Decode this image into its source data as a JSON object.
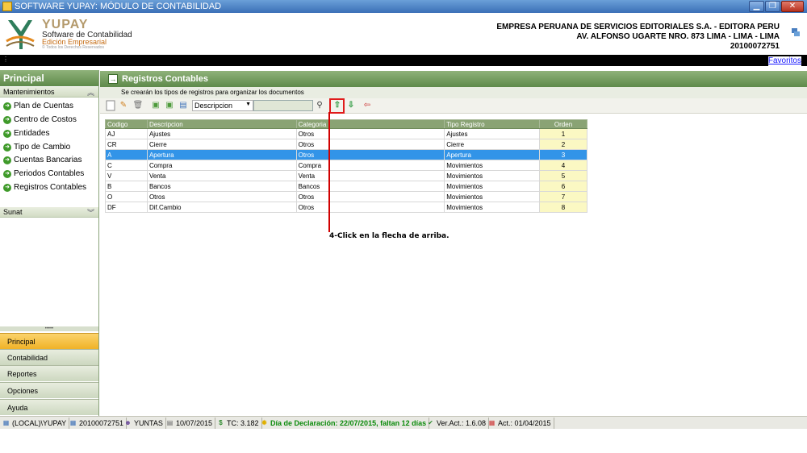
{
  "window": {
    "title": "SOFTWARE YUPAY: MÓDULO DE CONTABILIDAD",
    "minimize": "▁",
    "restore": "❐",
    "close": "✕"
  },
  "header": {
    "brand": "YUPAY",
    "tagline": "Software de Contabilidad",
    "edition": "Edición Empresarial",
    "rights": "© Todos los Derechos Reservados",
    "company_name": "EMPRESA PERUANA DE SERVICIOS EDITORIALES S.A. - EDITORA PERU",
    "company_address": "AV. ALFONSO UGARTE NRO. 873 LIMA - LIMA - LIMA",
    "company_ruc": "20100072751"
  },
  "topbar": {
    "favoritos": "Favoritos"
  },
  "sidebar": {
    "title": "Principal",
    "section_mantenimientos": "Mantenimientos",
    "items": [
      {
        "label": "Plan de Cuentas"
      },
      {
        "label": "Centro de Costos"
      },
      {
        "label": "Entidades"
      },
      {
        "label": "Tipo de Cambio"
      },
      {
        "label": "Cuentas Bancarias"
      },
      {
        "label": "Periodos Contables"
      },
      {
        "label": "Registros Contables"
      }
    ],
    "section_sunat": "Sunat",
    "grip": "•••••",
    "nav": [
      {
        "label": "Principal",
        "active": true
      },
      {
        "label": "Contabilidad"
      },
      {
        "label": "Reportes"
      },
      {
        "label": "Opciones"
      },
      {
        "label": "Ayuda"
      }
    ]
  },
  "main": {
    "title": "Registros Contables",
    "subtitle": "Se crearán los tipos de registros para organizar los documentos",
    "search_field": "Descripcion",
    "columns": [
      "Codigo",
      "Descripcion",
      "Categoria",
      "Tipo Registro",
      "Orden"
    ],
    "rows": [
      [
        "AJ",
        "Ajustes",
        "Otros",
        "Ajustes",
        "1"
      ],
      [
        "CR",
        "Cierre",
        "Otros",
        "Cierre",
        "2"
      ],
      [
        "A",
        "Apertura",
        "Otros",
        "Apertura",
        "3"
      ],
      [
        "C",
        "Compra",
        "Compra",
        "Movimientos",
        "4"
      ],
      [
        "V",
        "Venta",
        "Venta",
        "Movimientos",
        "5"
      ],
      [
        "B",
        "Bancos",
        "Bancos",
        "Movimientos",
        "6"
      ],
      [
        "O",
        "Otros",
        "Otros",
        "Movimientos",
        "7"
      ],
      [
        "DF",
        "Dif.Cambio",
        "Otros",
        "Movimientos",
        "8"
      ]
    ],
    "selected_row": 2
  },
  "annotation": "4-Click en la flecha de arriba.",
  "statusbar": {
    "server": "(LOCAL)\\YUPAY",
    "ruc": "20100072751",
    "user": "YUNTAS",
    "date": "10/07/2015",
    "tc": "TC: 3.182",
    "declaracion": "Día de Declaración: 22/07/2015, faltan 12 días",
    "version": "Ver.Act.: 1.6.08",
    "act": "Act.: 01/04/2015"
  },
  "colors": {
    "green_header": "#5e8a4a",
    "selected_row": "#3294e8",
    "annotation_red": "#d10000"
  }
}
